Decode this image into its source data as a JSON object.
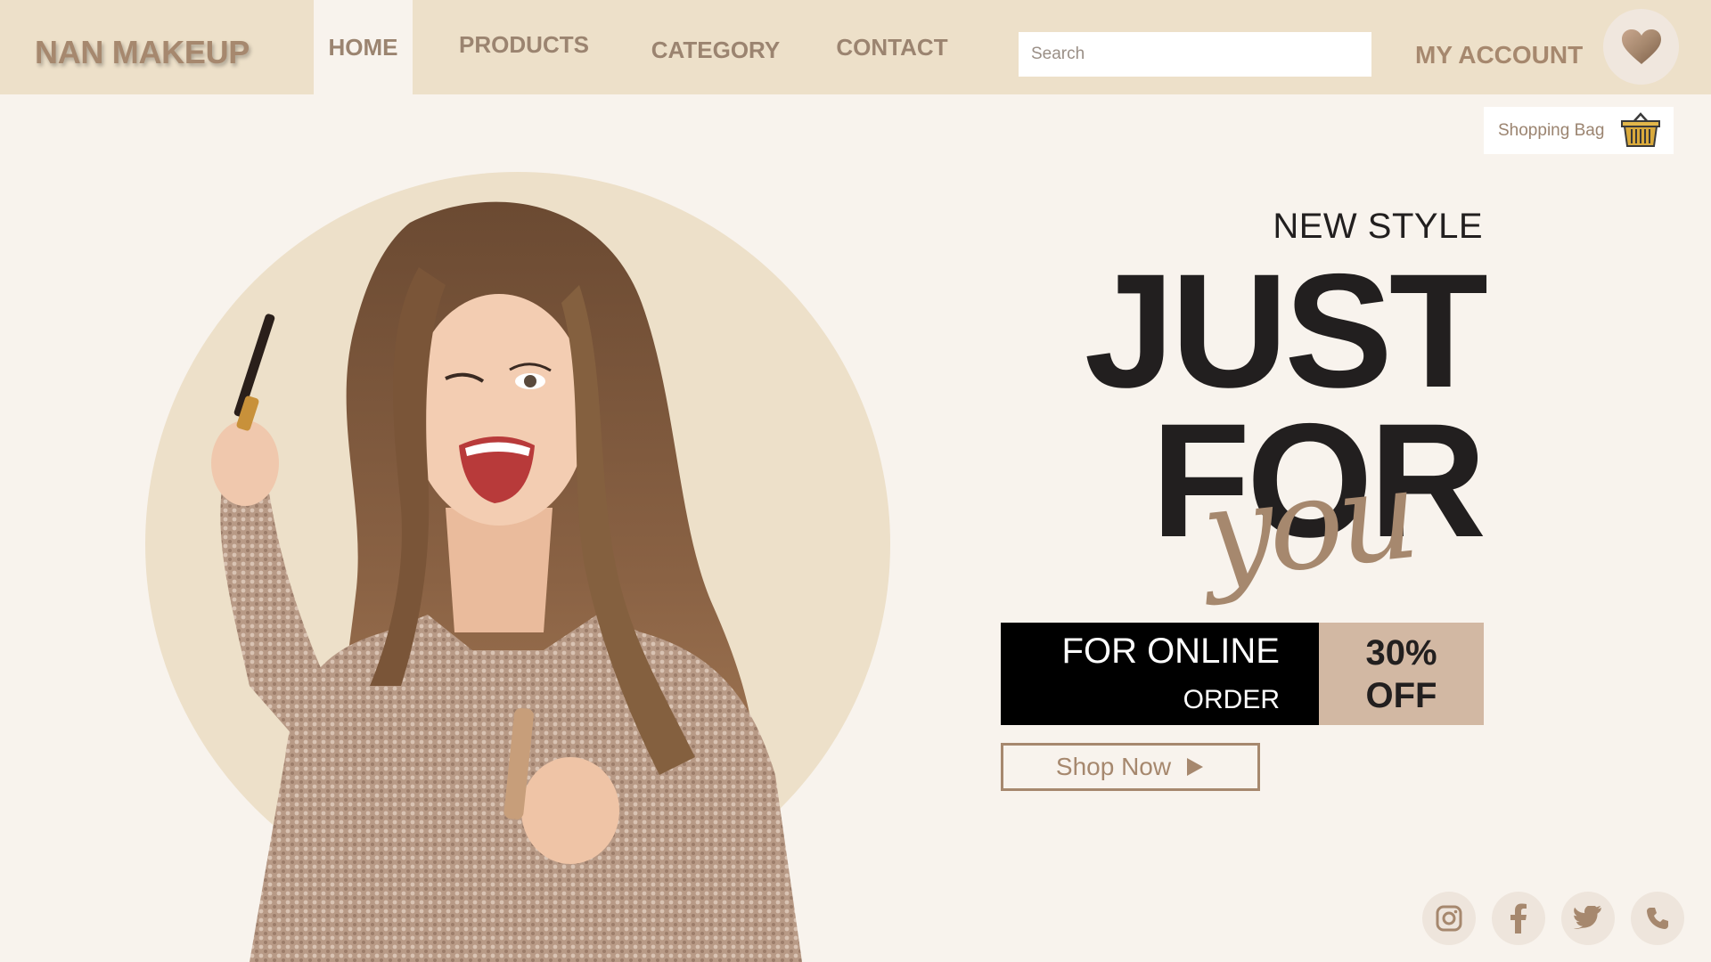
{
  "brand": {
    "name": "NAN MAKEUP"
  },
  "nav": {
    "home": "HOME",
    "products": "PRODUCTS",
    "category": "CATEGORY",
    "contact": "CONTACT",
    "active": "HOME"
  },
  "search": {
    "placeholder": "Search",
    "value": ""
  },
  "account": {
    "label": "MY ACCOUNT",
    "favorites_icon": "heart-icon"
  },
  "cart": {
    "label": "Shopping Bag",
    "icon": "basket-icon"
  },
  "hero": {
    "kicker": "NEW STYLE",
    "headline_1": "JUST",
    "headline_2": "FOR",
    "script_word": "you"
  },
  "offer": {
    "line_1": "FOR ONLINE",
    "line_2": "ORDER",
    "percent": "30%",
    "off": "OFF"
  },
  "cta": {
    "label": "Shop Now",
    "icon": "play-arrow-icon"
  },
  "social": [
    "instagram-icon",
    "facebook-icon",
    "twitter-icon",
    "phone-icon"
  ],
  "colors": {
    "header_bg": "#ede0c9",
    "page_bg": "#f8f3ed",
    "accent": "#a6886e",
    "offer_tag": "#d2b8a3",
    "ink": "#221f1f"
  }
}
